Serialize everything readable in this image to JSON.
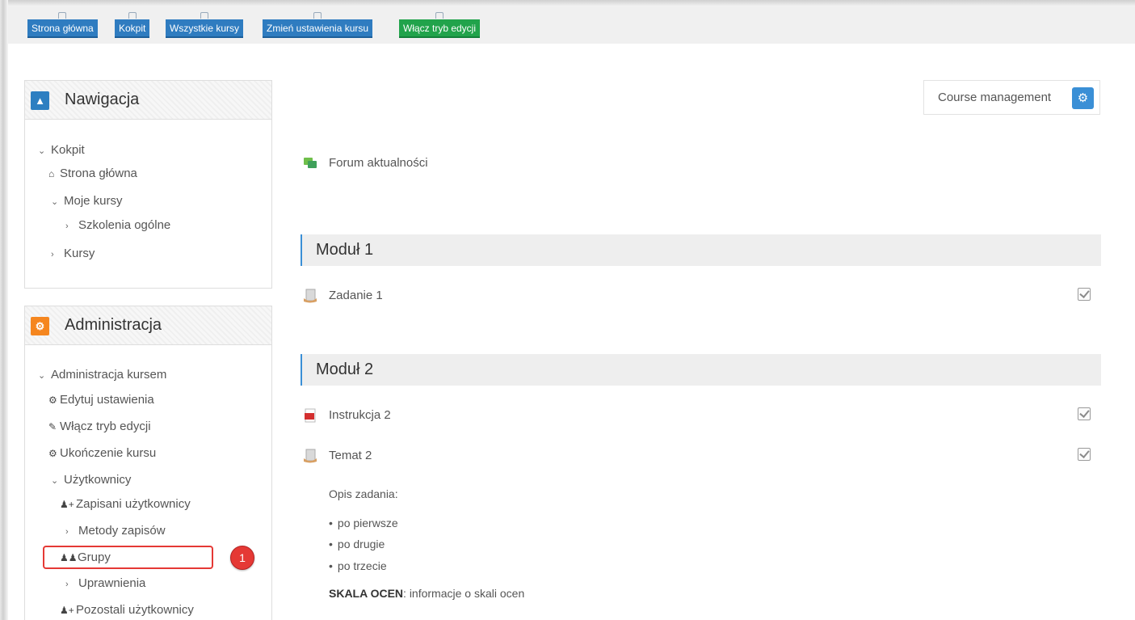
{
  "toolbar": {
    "home": "Strona główna",
    "dashboard": "Kokpit",
    "all_courses": "Wszystkie kursy",
    "course_settings": "Zmień ustawienia kursu",
    "edit_mode": "Włącz tryb edycji"
  },
  "navigation": {
    "title": "Nawigacja",
    "items": {
      "dashboard": "Kokpit",
      "home": "Strona główna",
      "my_courses": "Moje kursy",
      "general_training": "Szkolenia ogólne",
      "courses": "Kursy"
    }
  },
  "administration": {
    "title": "Administracja",
    "items": {
      "course_admin": "Administracja kursem",
      "edit_settings": "Edytuj ustawienia",
      "edit_mode": "Włącz tryb edycji",
      "completion": "Ukończenie kursu",
      "users": "Użytkownicy",
      "enrolled_users": "Zapisani użytkownicy",
      "enrolment_methods": "Metody zapisów",
      "groups": "Grupy",
      "permissions": "Uprawnienia",
      "other_users": "Pozostali użytkownicy"
    },
    "marker": "1"
  },
  "course_management": {
    "label": "Course management"
  },
  "content": {
    "forum": "Forum aktualności",
    "modules": [
      {
        "title": "Moduł 1"
      },
      {
        "title": "Moduł 2"
      }
    ],
    "activities": {
      "task1": "Zadanie 1",
      "instruction2": "Instrukcja 2",
      "topic2": "Temat 2"
    },
    "description": {
      "heading": "Opis zadania:",
      "bullets": [
        "po pierwsze",
        "po drugie",
        "po trzecie"
      ],
      "scale_label": "SKALA OCEN",
      "scale_text": ": informacje o skali ocen"
    }
  },
  "colors": {
    "primary": "#2f7cc0",
    "green": "#21a34b",
    "nav_icon": "#2d7fc1",
    "admin_icon": "#f5861f",
    "highlight": "#e53935"
  }
}
